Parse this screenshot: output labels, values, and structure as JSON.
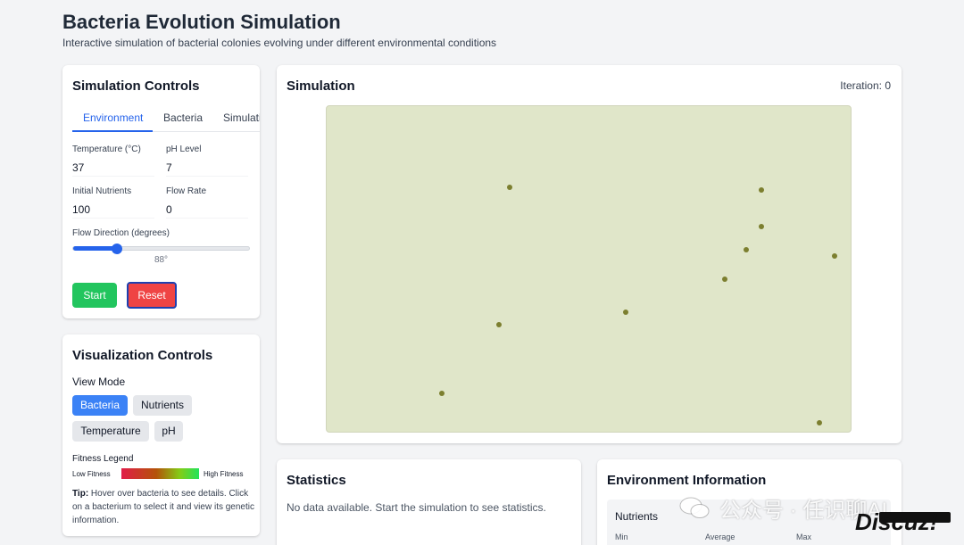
{
  "header": {
    "title": "Bacteria Evolution Simulation",
    "subtitle": "Interactive simulation of bacterial colonies evolving under different environmental conditions"
  },
  "controls": {
    "title": "Simulation Controls",
    "tabs": [
      {
        "label": "Environment",
        "active": true
      },
      {
        "label": "Bacteria",
        "active": false
      },
      {
        "label": "Simulation",
        "active": false
      }
    ],
    "fields": {
      "temperature": {
        "label": "Temperature (°C)",
        "value": "37"
      },
      "ph": {
        "label": "pH Level",
        "value": "7"
      },
      "nutrients": {
        "label": "Initial Nutrients",
        "value": "100"
      },
      "flow_rate": {
        "label": "Flow Rate",
        "value": "0"
      }
    },
    "flow_direction": {
      "label": "Flow Direction (degrees)",
      "value": 88,
      "min": 0,
      "max": 360,
      "display": "88°"
    },
    "start_label": "Start",
    "reset_label": "Reset"
  },
  "visualization": {
    "title": "Visualization Controls",
    "view_mode_label": "View Mode",
    "modes": [
      {
        "label": "Bacteria",
        "active": true
      },
      {
        "label": "Nutrients",
        "active": false
      },
      {
        "label": "Temperature",
        "active": false
      },
      {
        "label": "pH",
        "active": false
      }
    ],
    "legend_title": "Fitness Legend",
    "legend_low": "Low Fitness",
    "legend_high": "High Fitness",
    "tip_label": "Tip:",
    "tip_text": " Hover over bacteria to see details. Click on a bacterium to select it and view its genetic information."
  },
  "simulation": {
    "title": "Simulation",
    "iteration": "Iteration: 0",
    "background_color": "#e0e6c9",
    "bacterium_color": "#7c7f2f"
  },
  "statistics": {
    "title": "Statistics",
    "empty": "No data available. Start the simulation to see statistics."
  },
  "environment_info": {
    "title": "Environment Information",
    "nutrients_title": "Nutrients",
    "columns": [
      "Min",
      "Average",
      "Max"
    ]
  },
  "watermark": {
    "text": "公众号 · 任识聊AI",
    "logo": "Discuz!"
  }
}
